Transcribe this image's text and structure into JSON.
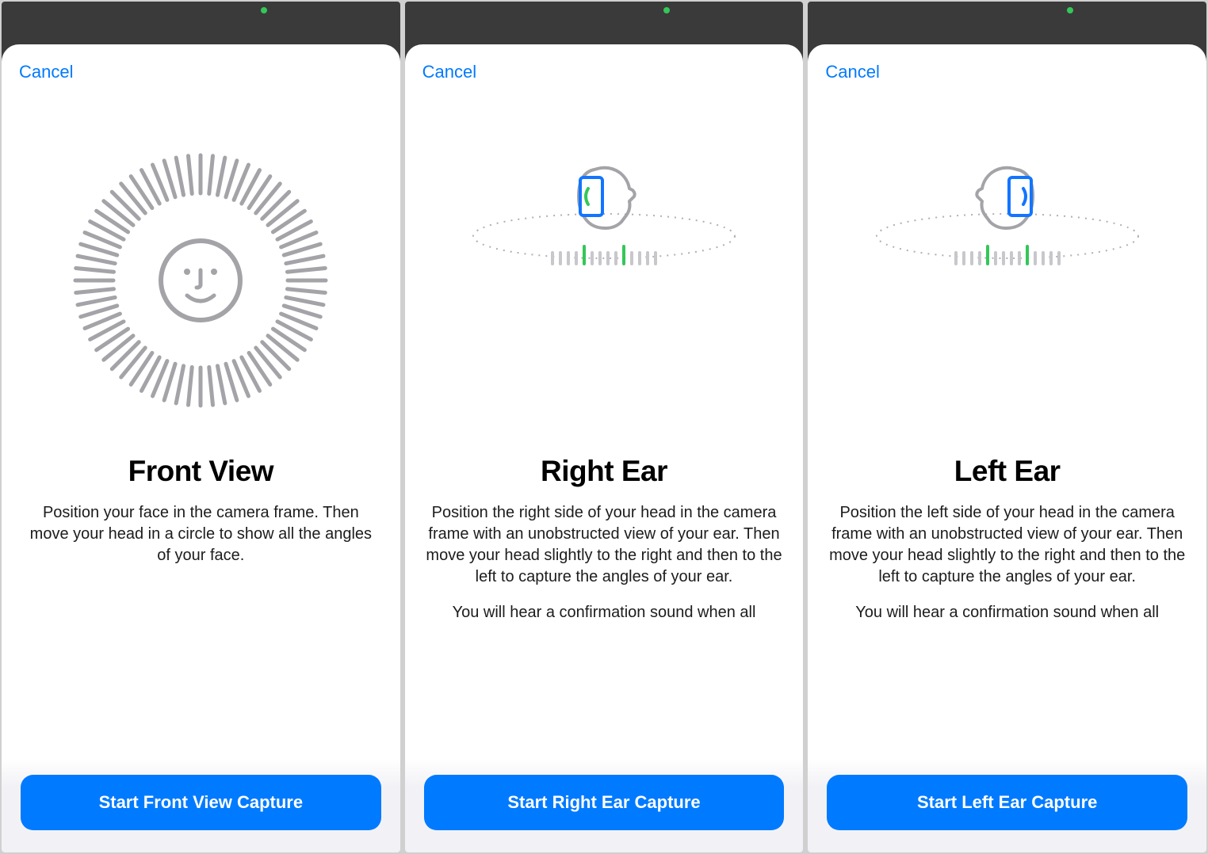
{
  "colors": {
    "accent": "#007aff",
    "green": "#34c759",
    "gray": "#c7c7cc"
  },
  "screens": [
    {
      "cancel": "Cancel",
      "title": "Front View",
      "desc": "Position your face in the camera frame. Then move your head in a circle to show all the angles of your face.",
      "desc2": "",
      "button": "Start Front View Capture"
    },
    {
      "cancel": "Cancel",
      "title": "Right Ear",
      "desc": "Position the right side of your head in the camera frame with an unobstructed view of your ear. Then move your head slightly to the right and then to the left to capture the angles of your ear.",
      "desc2": "You will hear a confirmation sound when all",
      "button": "Start Right Ear Capture"
    },
    {
      "cancel": "Cancel",
      "title": "Left Ear",
      "desc": "Position the left side of your head in the camera frame with an unobstructed view of your ear. Then move your head slightly to the right and then to the left to capture the angles of your ear.",
      "desc2": "You will hear a confirmation sound when all",
      "button": "Start Left Ear Capture"
    }
  ]
}
